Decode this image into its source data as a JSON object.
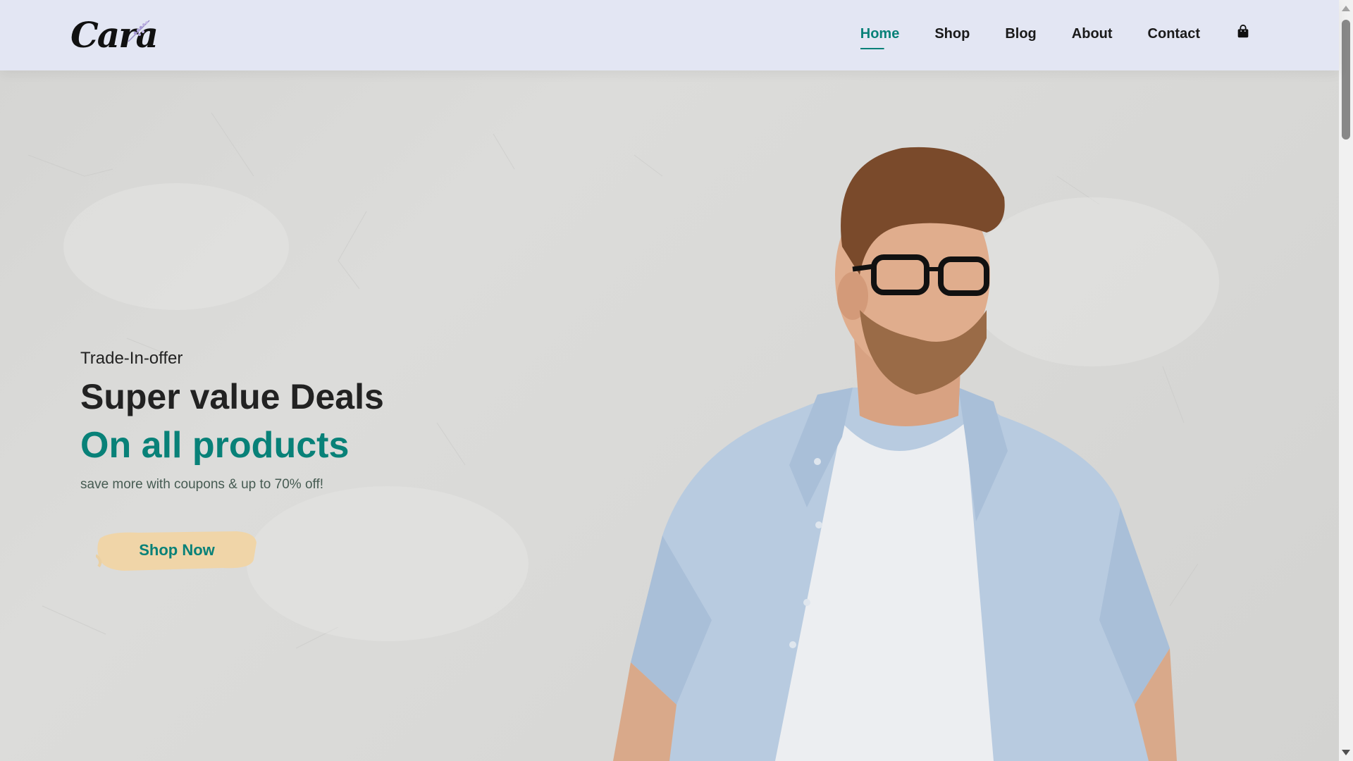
{
  "brand": {
    "logo_text": "Cara"
  },
  "nav": {
    "items": [
      {
        "label": "Home",
        "active": true
      },
      {
        "label": "Shop",
        "active": false
      },
      {
        "label": "Blog",
        "active": false
      },
      {
        "label": "About",
        "active": false
      },
      {
        "label": "Contact",
        "active": false
      }
    ],
    "cart_icon": "shopping-bag-icon"
  },
  "hero": {
    "eyebrow": "Trade-In-offer",
    "headline": "Super value Deals",
    "highlight": "On all products",
    "subtext": "save more with coupons & up to 70% off!",
    "cta_label": "Shop Now"
  },
  "colors": {
    "accent": "#088178",
    "header_bg": "#e3e6f3",
    "text_dark": "#222222",
    "cta_brush": "#f0d5a8"
  }
}
